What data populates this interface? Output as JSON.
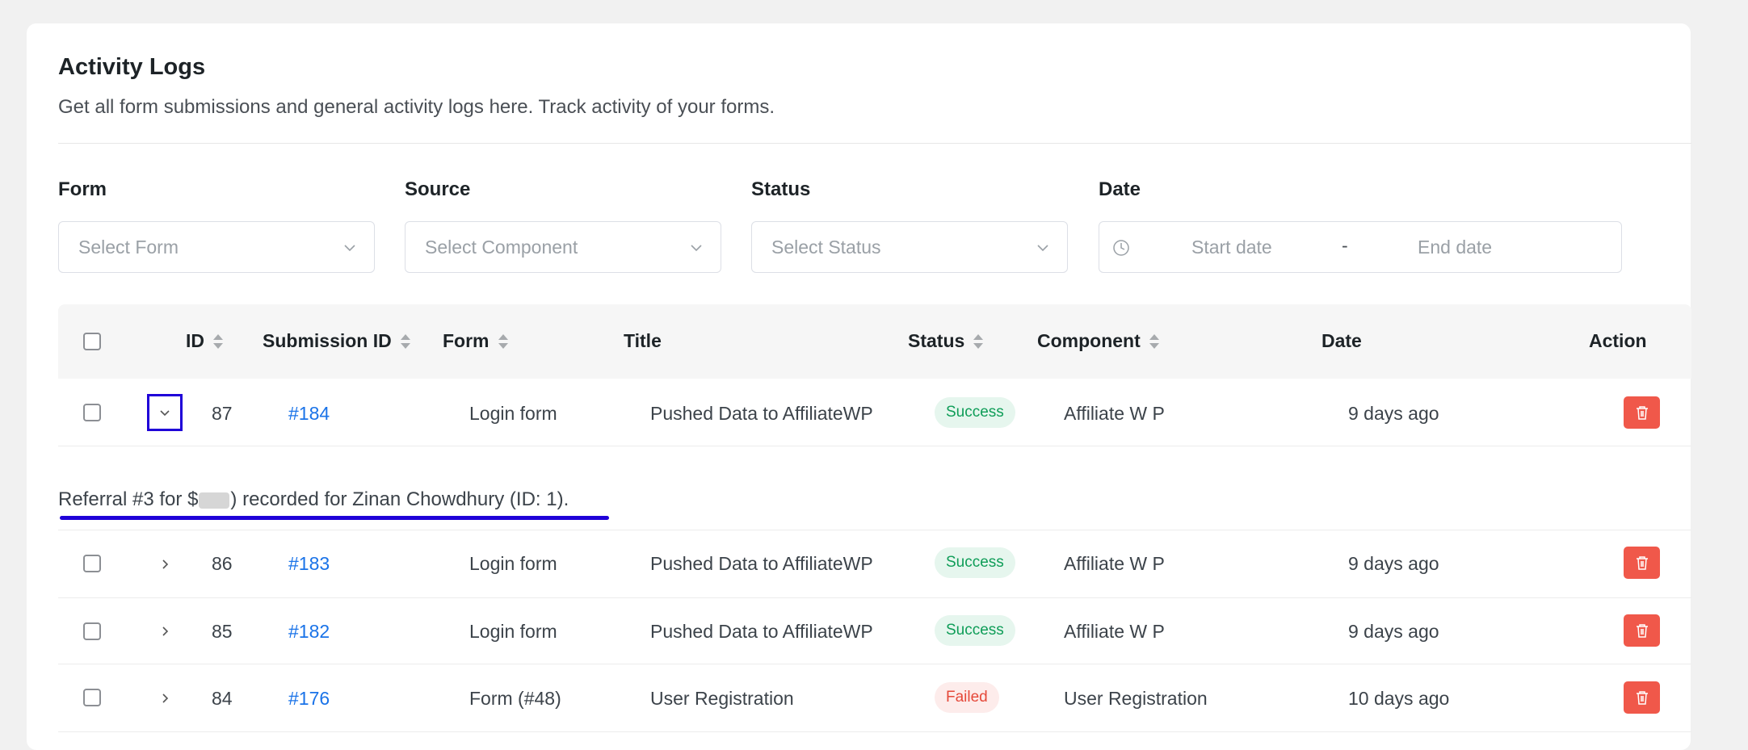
{
  "header": {
    "title": "Activity Logs",
    "description": "Get all form submissions and general activity logs here. Track activity of your forms."
  },
  "filters": {
    "form": {
      "label": "Form",
      "placeholder": "Select Form"
    },
    "source": {
      "label": "Source",
      "placeholder": "Select Component"
    },
    "status": {
      "label": "Status",
      "placeholder": "Select Status"
    },
    "date": {
      "label": "Date",
      "start_placeholder": "Start date",
      "separator": "-",
      "end_placeholder": "End date"
    }
  },
  "table": {
    "columns": {
      "id": "ID",
      "submission_id": "Submission ID",
      "form": "Form",
      "title": "Title",
      "status": "Status",
      "component": "Component",
      "date": "Date",
      "action": "Action"
    },
    "rows": [
      {
        "id": "87",
        "submission_id": "#184",
        "form": "Login form",
        "title": "Pushed Data to AffiliateWP",
        "status": "Success",
        "component": "Affiliate W P",
        "date": "9 days ago",
        "expanded": true
      },
      {
        "id": "86",
        "submission_id": "#183",
        "form": "Login form",
        "title": "Pushed Data to AffiliateWP",
        "status": "Success",
        "component": "Affiliate W P",
        "date": "9 days ago",
        "expanded": false
      },
      {
        "id": "85",
        "submission_id": "#182",
        "form": "Login form",
        "title": "Pushed Data to AffiliateWP",
        "status": "Success",
        "component": "Affiliate W P",
        "date": "9 days ago",
        "expanded": false
      },
      {
        "id": "84",
        "submission_id": "#176",
        "form": "Form (#48)",
        "title": "User Registration",
        "status": "Failed",
        "component": "User Registration",
        "date": "10 days ago",
        "expanded": false
      }
    ],
    "expanded_detail": {
      "before": "Referral #3 for $",
      "after": ") recorded for Zinan Chowdhury (ID: 1)."
    }
  },
  "colors": {
    "success": "#0f9d58",
    "failed": "#e5493a",
    "link": "#1a73e8",
    "delete": "#f0584a",
    "highlight": "#1f00d8"
  },
  "icons": [
    "chevron-down-icon",
    "chevron-right-icon",
    "clock-icon",
    "sort-icon",
    "trash-icon"
  ]
}
